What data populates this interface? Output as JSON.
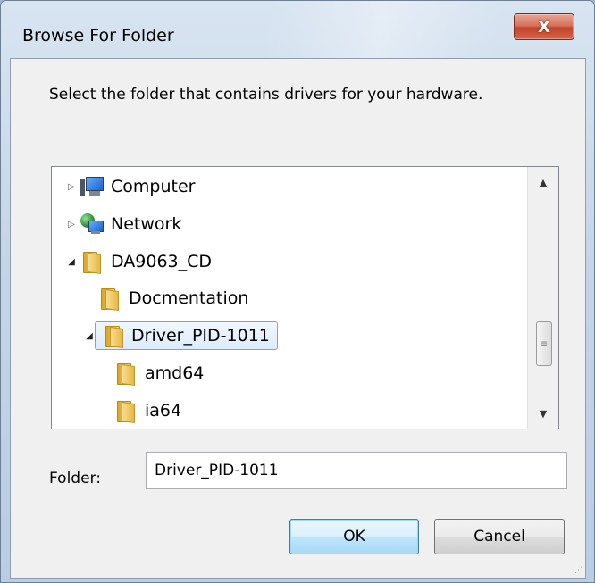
{
  "window": {
    "title": "Browse For Folder",
    "close_label": "X"
  },
  "instruction": "Select the folder that contains drivers for your hardware.",
  "tree": {
    "items": [
      {
        "label": "Computer",
        "icon": "computer-icon",
        "expander": "collapsed",
        "level": 0
      },
      {
        "label": "Network",
        "icon": "network-icon",
        "expander": "collapsed",
        "level": 0
      },
      {
        "label": "DA9063_CD",
        "icon": "folder-icon",
        "expander": "expanded",
        "level": 0
      },
      {
        "label": "Docmentation",
        "icon": "folder-icon",
        "expander": "none",
        "level": 1
      },
      {
        "label": "Driver_PID-1011",
        "icon": "folder-icon",
        "expander": "expanded",
        "level": 1,
        "selected": true
      },
      {
        "label": "amd64",
        "icon": "folder-icon",
        "expander": "none",
        "level": 2
      },
      {
        "label": "ia64",
        "icon": "folder-icon",
        "expander": "none",
        "level": 2
      }
    ]
  },
  "folder": {
    "label": "Folder:",
    "value": "Driver_PID-1011"
  },
  "buttons": {
    "ok": "OK",
    "cancel": "Cancel"
  },
  "colors": {
    "selection_border": "#7da2ce",
    "close_red": "#c0442a",
    "default_button_blue": "#3c7fb1"
  }
}
